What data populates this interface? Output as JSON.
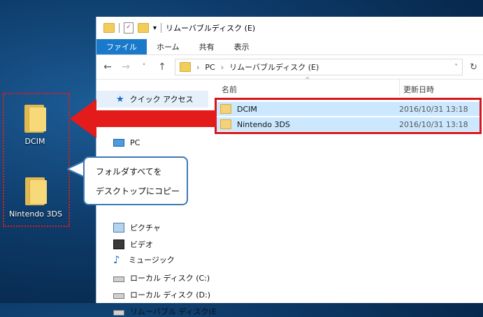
{
  "desktop": {
    "icons": [
      {
        "label": "DCIM",
        "icon": "folder-icon"
      },
      {
        "label": "Nintendo 3DS",
        "icon": "folder-icon"
      }
    ]
  },
  "callout": {
    "line1": "フォルダすべてを",
    "line2": "デスクトップにコピー"
  },
  "window": {
    "title": "リムーバブルディスク (E)",
    "ribbon_tabs": [
      "ファイル",
      "ホーム",
      "共有",
      "表示"
    ],
    "address": {
      "root": "PC",
      "current": "リムーバブルディスク (E)"
    },
    "nav": {
      "quick_access": "クイック アクセス",
      "pc": "PC",
      "pictures": "ピクチャ",
      "videos": "ビデオ",
      "music": "ミュージック",
      "local_c": "ローカル ディスク (C:)",
      "local_d": "ローカル ディスク (D:)",
      "removable": "リムーバブル ディスク(E"
    },
    "columns": {
      "name": "名前",
      "modified": "更新日時"
    },
    "files": [
      {
        "name": "DCIM",
        "modified": "2016/10/31 13:18"
      },
      {
        "name": "Nintendo 3DS",
        "modified": "2016/10/31 13:18"
      }
    ]
  },
  "colors": {
    "accent_blue": "#1979ca",
    "highlight_red": "#d9151c",
    "selection": "#cce8ff"
  }
}
